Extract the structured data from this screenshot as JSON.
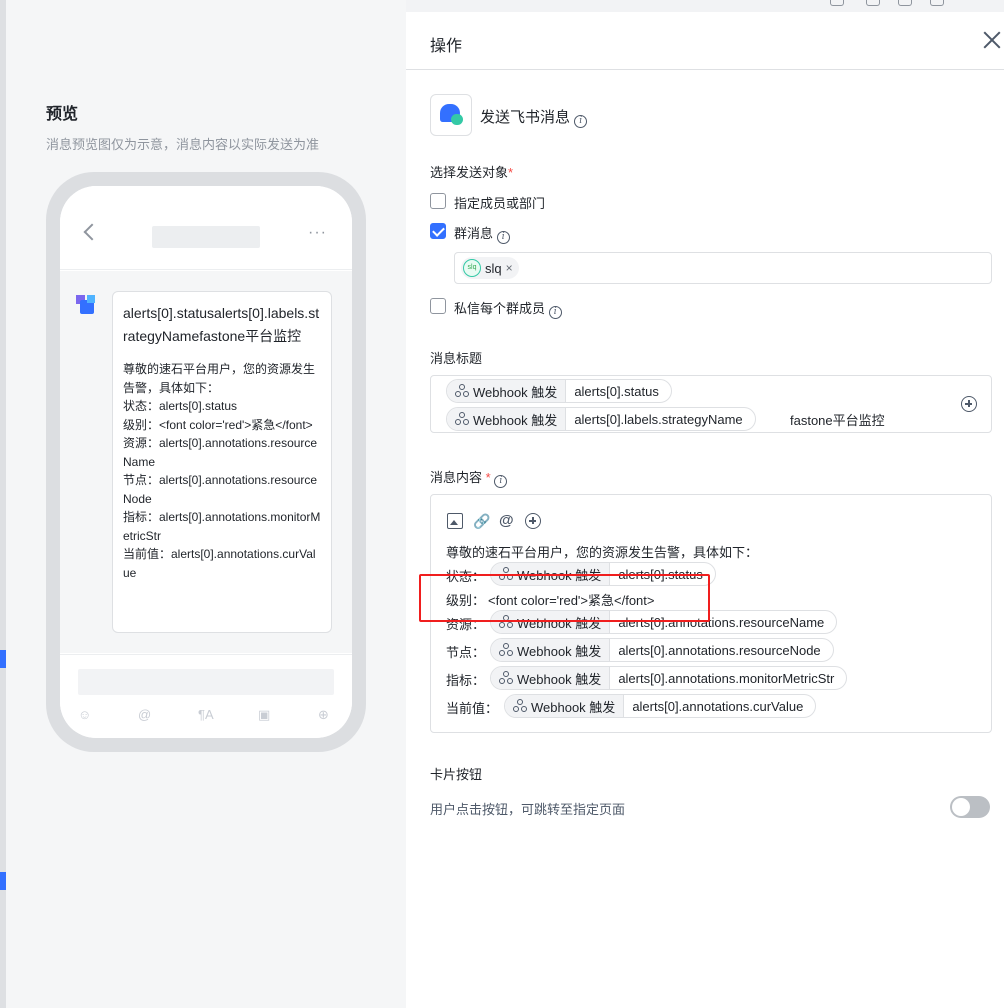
{
  "preview": {
    "title": "预览",
    "subtitle": "消息预览图仅为示意，消息内容以实际发送为准",
    "dots": "···",
    "message_title": "alerts[0].statusalerts[0].labels.strategyNamefastone平台监控",
    "message_lines": [
      "尊敬的速石平台用户，您的资源发生告警，具体如下：",
      "状态：alerts[0].status",
      "级别：<font color='red'>紧急</font>",
      "资源：alerts[0].annotations.resourceName",
      "节点：alerts[0].annotations.resourceNode",
      "指标：alerts[0].annotations.monitorMetricStr",
      "当前值：alerts[0].annotations.curValue"
    ],
    "toolbar_glyphs": [
      "☺",
      "@",
      "¶A",
      "▣",
      "⊕"
    ]
  },
  "drawer": {
    "title": "操作",
    "action_name": "发送飞书消息",
    "info_glyph": "i",
    "target_label": "选择发送对象",
    "required_mark": "*",
    "options": {
      "members": "指定成员或部门",
      "group": "群消息",
      "private": "私信每个群成员"
    },
    "selected_group": {
      "avatar_text": "slq",
      "name": "slq",
      "remove": "×"
    },
    "msg_title_label": "消息标题",
    "title_tokens": [
      {
        "source": "Webhook 触发",
        "value": "alerts[0].status"
      },
      {
        "source": "Webhook 触发",
        "value": "alerts[0].labels.strategyName"
      }
    ],
    "title_suffix": "fastone平台监控",
    "msg_content_label": "消息内容",
    "content_intro": "尊敬的速石平台用户，您的资源发生告警，具体如下：",
    "content_rows": {
      "status": {
        "label": "状态：",
        "source": "Webhook 触发",
        "value": "alerts[0].status"
      },
      "level": {
        "label": "级别：",
        "text": "<font color='red'>紧急</font>"
      },
      "resource": {
        "label": "资源：",
        "source": "Webhook 触发",
        "value": "alerts[0].annotations.resourceName"
      },
      "node": {
        "label": "节点：",
        "source": "Webhook 触发",
        "value": "alerts[0].annotations.resourceNode"
      },
      "metric": {
        "label": "指标：",
        "source": "Webhook 触发",
        "value": "alerts[0].annotations.monitorMetricStr"
      },
      "cur": {
        "label": "当前值：",
        "source": "Webhook 触发",
        "value": "alerts[0].annotations.curValue"
      }
    },
    "card_button_label": "卡片按钮",
    "card_button_desc": "用户点击按钮，可跳转至指定页面",
    "toolbar": {
      "link_glyph": "🔗",
      "at_glyph": "@"
    }
  },
  "colors": {
    "accent": "#3370ff",
    "highlight": "#f01e1e",
    "toggle_off": "#bbbfc4"
  }
}
